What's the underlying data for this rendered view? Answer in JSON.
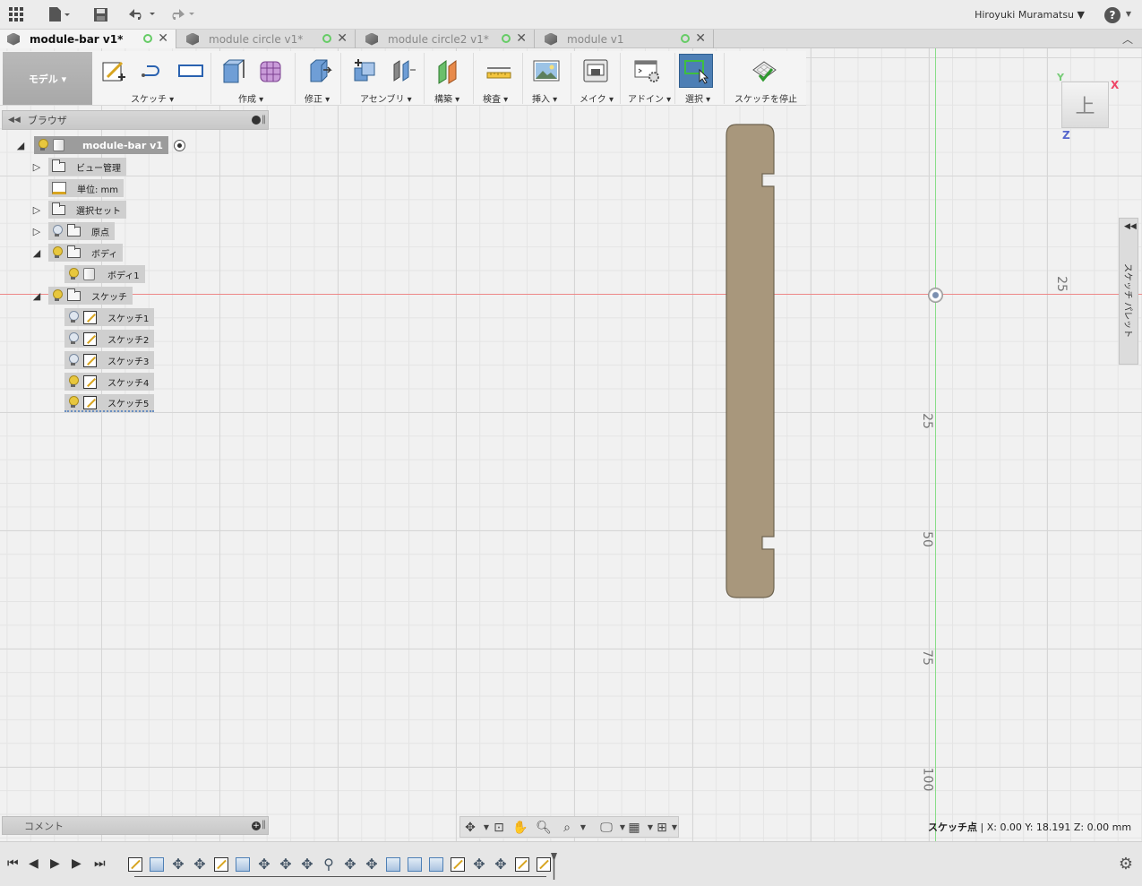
{
  "app": {
    "user_name": "Hiroyuki Muramatsu ▼",
    "help_label": "?",
    "tabs": [
      {
        "label": "module-bar v1*",
        "active": true
      },
      {
        "label": "module circle v1*",
        "active": false
      },
      {
        "label": "module circle2 v1*",
        "active": false
      },
      {
        "label": "module v1",
        "active": false
      }
    ]
  },
  "toolbar": {
    "mode_label": "モデル ▾",
    "groups": [
      {
        "label": "スケッチ ▾"
      },
      {
        "label": "作成 ▾"
      },
      {
        "label": "修正 ▾"
      },
      {
        "label": "アセンブリ ▾"
      },
      {
        "label": "構築 ▾"
      },
      {
        "label": "検査 ▾"
      },
      {
        "label": "挿入 ▾"
      },
      {
        "label": "メイク ▾"
      },
      {
        "label": "アドイン ▾"
      },
      {
        "label": "選択 ▾"
      },
      {
        "label": "スケッチを停止"
      }
    ]
  },
  "browser": {
    "title": "ブラウザ",
    "root": "module-bar v1",
    "items": [
      {
        "label": "ビュー管理"
      },
      {
        "label": "単位: mm"
      },
      {
        "label": "選択セット"
      },
      {
        "label": "原点"
      },
      {
        "label": "ボディ"
      },
      {
        "label": "ボディ1"
      },
      {
        "label": "スケッチ"
      },
      {
        "label": "スケッチ1"
      },
      {
        "label": "スケッチ2"
      },
      {
        "label": "スケッチ3"
      },
      {
        "label": "スケッチ4"
      },
      {
        "label": "スケッチ5"
      }
    ]
  },
  "viewport": {
    "viewcube_face": "上",
    "axis_x": "X",
    "axis_y": "Y",
    "axis_z": "Z",
    "ticks": [
      "25",
      "25",
      "50",
      "75",
      "100"
    ],
    "part_color": "#a8977c"
  },
  "palette": {
    "label": "スケッチ パレット"
  },
  "comment": {
    "label": "コメント"
  },
  "status": {
    "prefix": "スケッチ点",
    "coords": "| X: 0.00 Y: 18.191 Z: 0.00 mm"
  }
}
